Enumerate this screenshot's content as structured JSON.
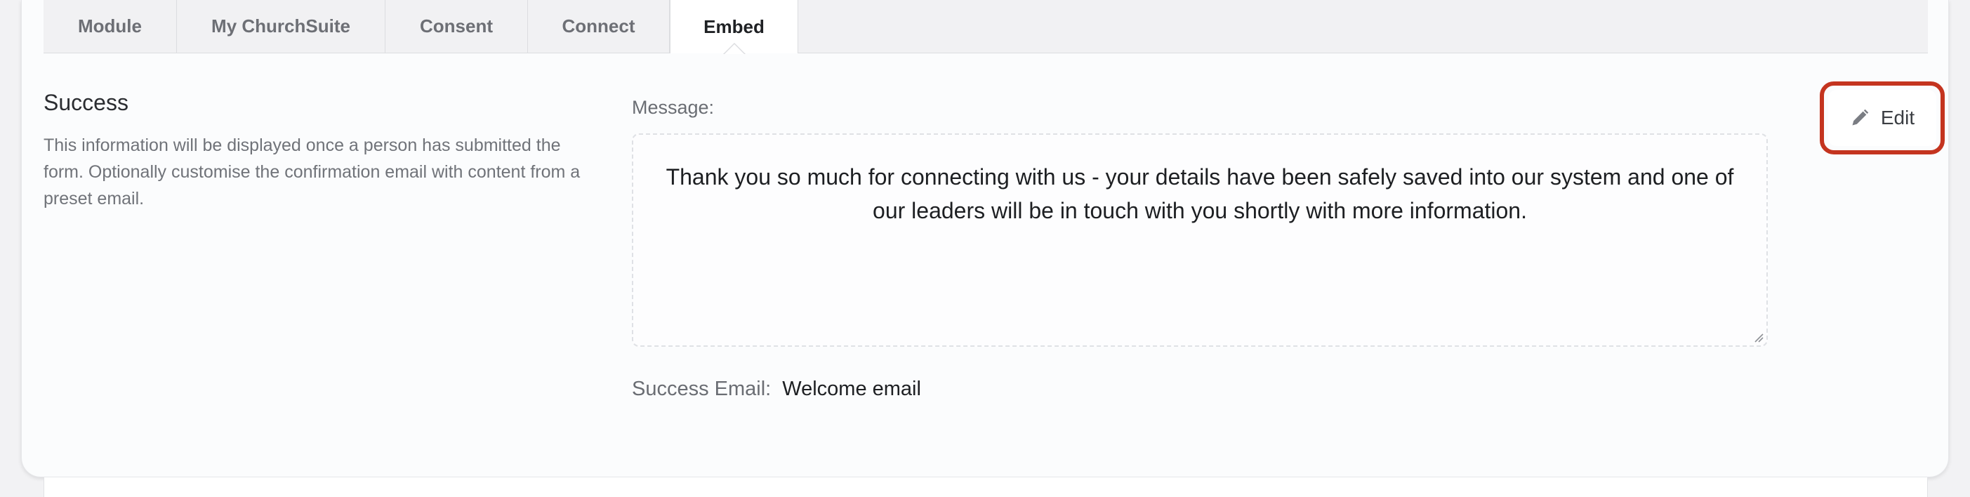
{
  "tabs": [
    {
      "label": "Module",
      "active": false
    },
    {
      "label": "My ChurchSuite",
      "active": false
    },
    {
      "label": "Consent",
      "active": false
    },
    {
      "label": "Connect",
      "active": false
    },
    {
      "label": "Embed",
      "active": true
    }
  ],
  "success": {
    "title": "Success",
    "description": "This information will be displayed once a person has submitted the form. Optionally customise the confirmation email with content from a preset email.",
    "message_label": "Message:",
    "message_text": "Thank you so much for connecting with us - your details have been safely saved into our system and one of our leaders will be in touch with you shortly with more information.",
    "email_label": "Success Email:",
    "email_value": "Welcome email"
  },
  "actions": {
    "edit_label": "Edit",
    "edit_icon": "pencil-icon",
    "highlight_color": "#c4341f"
  }
}
